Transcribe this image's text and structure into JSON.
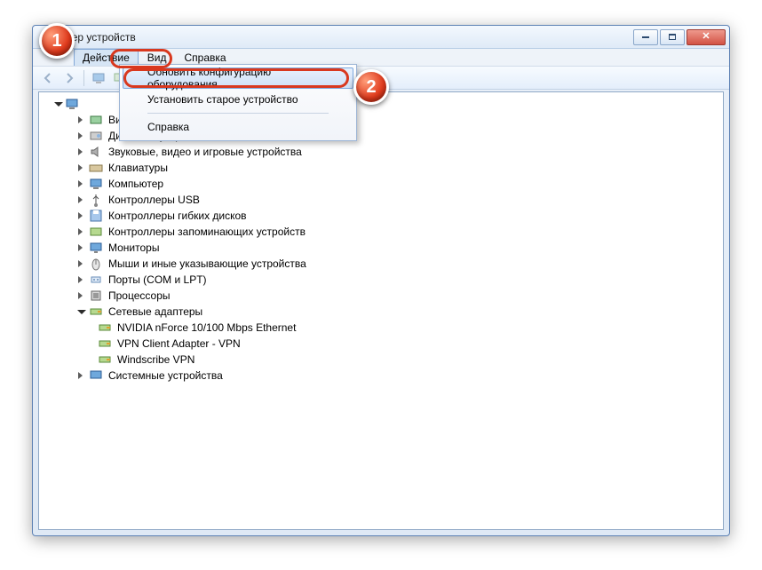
{
  "window": {
    "title": "тчер устройств"
  },
  "menubar": {
    "action": "Действие",
    "view": "Вид",
    "help": "Справка"
  },
  "dropdown": {
    "refresh": "Обновить конфигурацию оборудования",
    "install": "Установить старое устройство",
    "help": "Справка"
  },
  "tree": {
    "items": [
      {
        "label": "Видеоадаптеры"
      },
      {
        "label": "Дисковые устройства"
      },
      {
        "label": "Звуковые, видео и игровые устройства"
      },
      {
        "label": "Клавиатуры"
      },
      {
        "label": "Компьютер"
      },
      {
        "label": "Контроллеры USB"
      },
      {
        "label": "Контроллеры гибких дисков"
      },
      {
        "label": "Контроллеры запоминающих устройств"
      },
      {
        "label": "Мониторы"
      },
      {
        "label": "Мыши и иные указывающие устройства"
      },
      {
        "label": "Порты (COM и LPT)"
      },
      {
        "label": "Процессоры"
      }
    ],
    "network": {
      "label": "Сетевые адаптеры",
      "children": [
        {
          "label": "NVIDIA nForce 10/100 Mbps Ethernet"
        },
        {
          "label": "VPN Client Adapter - VPN"
        },
        {
          "label": "Windscribe VPN"
        }
      ]
    },
    "system": {
      "label": "Системные устройства"
    }
  },
  "callouts": {
    "one": "1",
    "two": "2"
  }
}
